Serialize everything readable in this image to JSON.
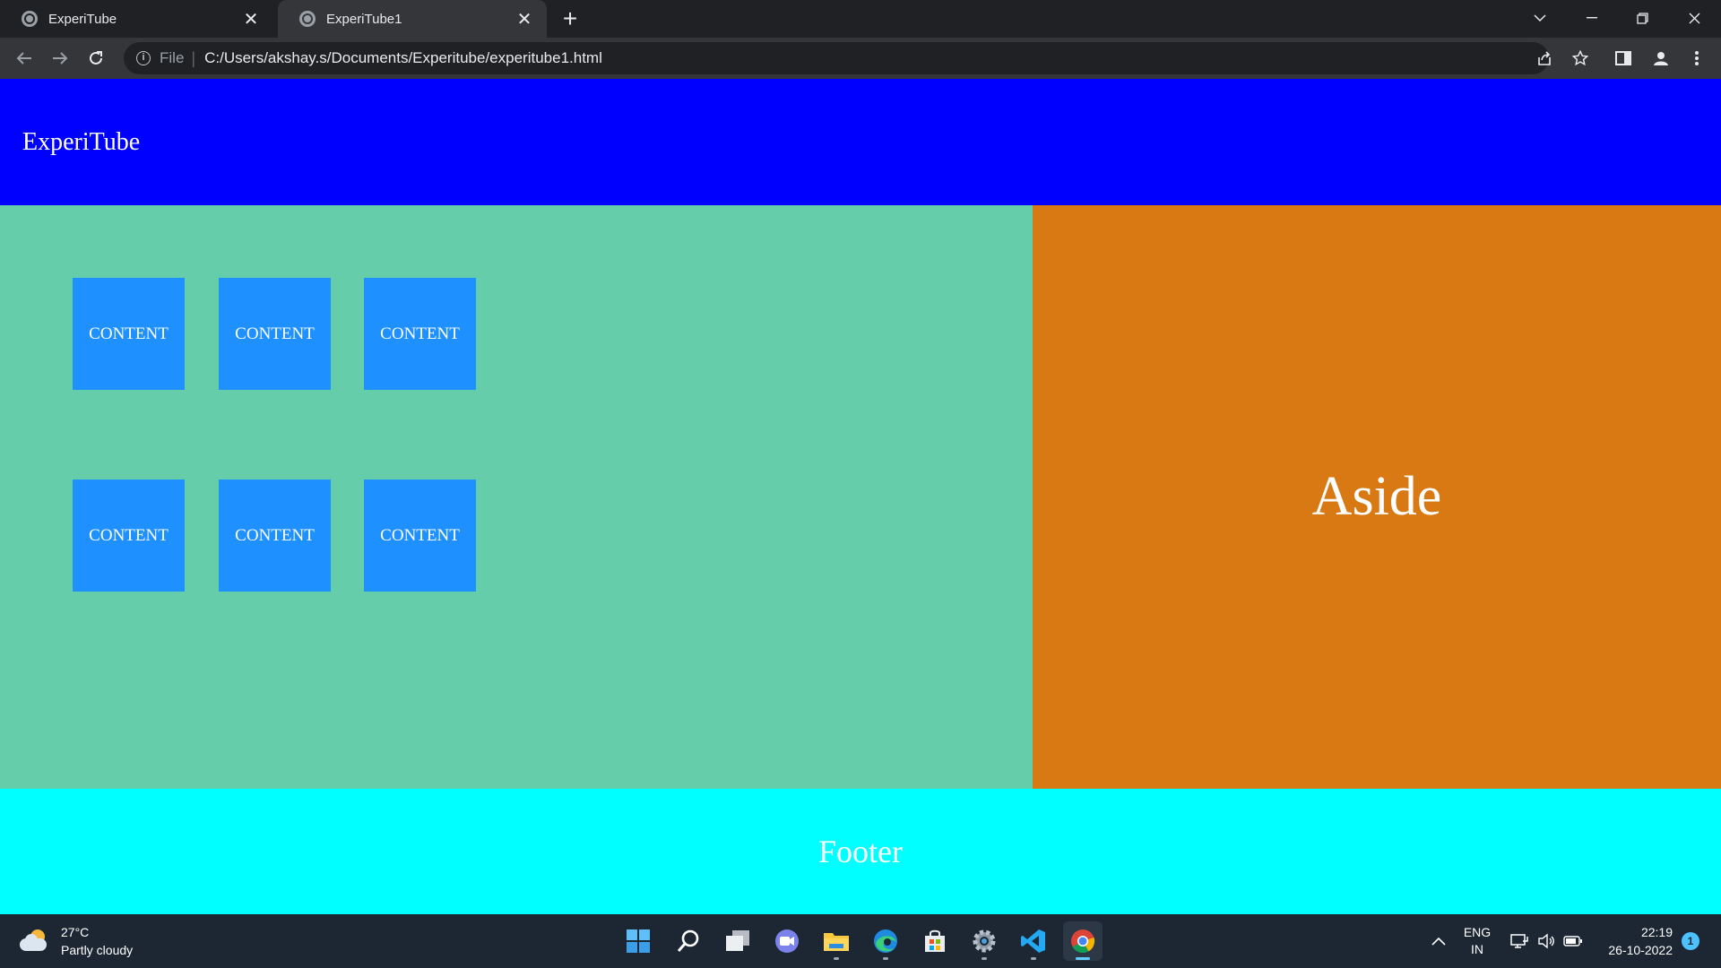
{
  "browser": {
    "tabs": [
      {
        "title": "ExperiTube",
        "active": false
      },
      {
        "title": "ExperiTube1",
        "active": true
      }
    ],
    "address": {
      "scheme": "File",
      "url": "C:/Users/akshay.s/Documents/Experitube/experitube1.html"
    }
  },
  "page": {
    "header": {
      "title": "ExperiTube"
    },
    "content_items": [
      "CONTENT",
      "CONTENT",
      "CONTENT",
      "CONTENT",
      "CONTENT",
      "CONTENT"
    ],
    "aside": {
      "label": "Aside"
    },
    "footer": {
      "label": "Footer"
    },
    "colors": {
      "header": "#0000ff",
      "main": "#66cdaa",
      "card": "#1e90ff",
      "aside": "#d97914",
      "footer": "#00ffff"
    }
  },
  "taskbar": {
    "weather": {
      "temp": "27°C",
      "condition": "Partly cloudy"
    },
    "apps": [
      "start-icon",
      "search-icon",
      "task-view-icon",
      "chat-icon",
      "file-explorer-icon",
      "edge-icon",
      "store-icon",
      "settings-icon",
      "vscode-icon",
      "chrome-icon"
    ],
    "language": {
      "line1": "ENG",
      "line2": "IN"
    },
    "clock": {
      "time": "22:19",
      "date": "26-10-2022"
    },
    "notification_count": "1"
  }
}
